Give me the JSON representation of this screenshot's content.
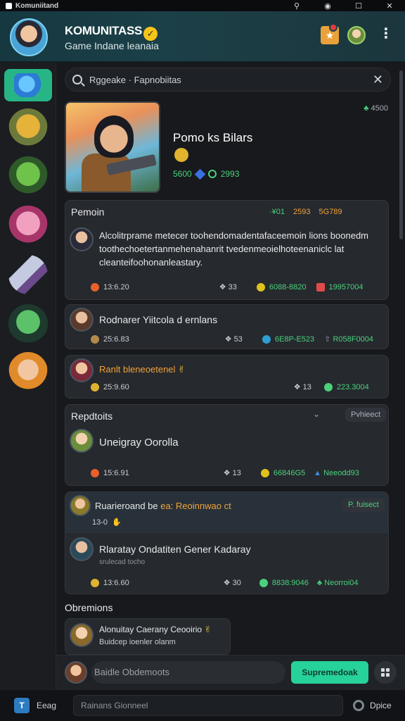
{
  "window": {
    "title": "Komuniitand"
  },
  "header": {
    "title": "KOMUNITASS",
    "subtitle": "Game Indane leanaia",
    "trophy_icon": "trophy-icon",
    "more_icon": "more-vertical-icon"
  },
  "search": {
    "query": "Rggeake · Fapnobiitas",
    "clear_icon": "close-icon"
  },
  "game": {
    "name": "Pomo ks Bilars",
    "stat1": "5600",
    "stat2": "2993",
    "follow_count": "4500"
  },
  "sections": {
    "pemoin": "Pemoin",
    "repotoits": "Repdtoits",
    "obremions": "Obremions"
  },
  "pemoin_tags": {
    "t1": "·¥01",
    "t2": "2593",
    "t3": "5G789"
  },
  "posts": [
    {
      "text": "Alcolitrprame metecer toohendomadentafaceemoin lions boonedm toothechoetertanmehenahanrit tvedenmeoielhoteenaniclc lat cleanteifoohonanleastary.",
      "time": "13:6.20",
      "comments": "33",
      "likes": "6088-8820",
      "shares": "19957004"
    },
    {
      "text": "Rodnarer Yiitcola d ernlans",
      "time": "25:6.83",
      "comments": "53",
      "likes": "6E8P-E523",
      "shares": "R058F0004"
    },
    {
      "text": "Ranlt bleneoetenel",
      "time": "25:9.60",
      "comments": "13",
      "likes": "223.3004"
    },
    {
      "text": "Uneigray Oorolla",
      "time": "15:6.91",
      "comments": "13",
      "likes": "66846G5",
      "shares": "Neeodd93"
    },
    {
      "header_text": "Ruarieroand be",
      "header_highlight": "ea: Reoinnwao ct",
      "header_meta": "13-0",
      "text": "Rlaratay Ondatiten Gener Kadaray",
      "subtext": "srulecad tocho",
      "time": "13:6.60",
      "comments": "30",
      "likes": "8838:9046",
      "shares": "Neorroi04"
    }
  ],
  "pills": {
    "repotoits_btn": "Pvhieect",
    "post5_btn": "P. fuisect"
  },
  "obremions_item": {
    "title": "Alonuitay Caerany Ceooirio",
    "sub": "Buidcep ioenler olanm"
  },
  "composer": {
    "placeholder": "Baidle Obdemoots",
    "button": "Supremedoak"
  },
  "bottombar": {
    "label": "Eeag",
    "input": "Rainans Gionneel",
    "option": "Dpice"
  }
}
